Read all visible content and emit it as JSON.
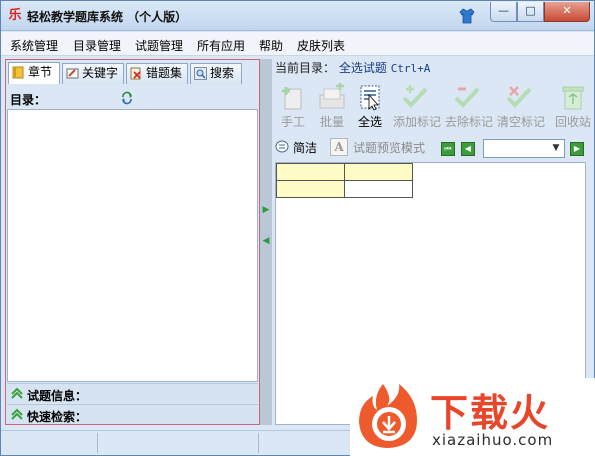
{
  "window": {
    "title": "轻松教学题库系统 （个人版）",
    "app_icon_glyph": "乐",
    "controls": {
      "minimize": "—",
      "maximize": "□",
      "close": "✕"
    }
  },
  "menu": {
    "items": [
      "系统管理",
      "目录管理",
      "试题管理",
      "所有应用",
      "帮助",
      "皮肤列表"
    ]
  },
  "left_panel": {
    "tabs": [
      {
        "label": "章节",
        "icon": "book-icon",
        "active": true
      },
      {
        "label": "关键字",
        "icon": "keyword-icon",
        "active": false
      },
      {
        "label": "错题集",
        "icon": "wrong-set-icon",
        "active": false
      },
      {
        "label": "搜索",
        "icon": "search-icon",
        "active": false
      }
    ],
    "catalog_label": "目录：",
    "sections": [
      {
        "label": "试题信息：",
        "icon": "expand-up-icon"
      },
      {
        "label": "快速检索：",
        "icon": "expand-up-icon"
      }
    ]
  },
  "splitter": {
    "right_arrow": "▶",
    "left_arrow": "◀"
  },
  "right_panel": {
    "current_dir_label": "当前目录：",
    "current_dir_value": "全选试题",
    "shortcut": "Ctrl+A",
    "toolbar": [
      {
        "label": "手工",
        "icon": "manual-add-icon",
        "enabled": false
      },
      {
        "label": "批量",
        "icon": "batch-icon",
        "enabled": false
      },
      {
        "label": "全选",
        "icon": "select-all-icon",
        "enabled": true
      },
      {
        "label": "添加标记",
        "icon": "add-mark-icon",
        "enabled": false
      },
      {
        "label": "去除标记",
        "icon": "remove-mark-icon",
        "enabled": false
      },
      {
        "label": "清空标记",
        "icon": "clear-mark-icon",
        "enabled": false
      },
      {
        "label": "回收站",
        "icon": "recycle-bin-icon",
        "enabled": false
      }
    ],
    "simple_label": "简洁",
    "preview_icon_letter": "A",
    "preview_label": "试题预览模式",
    "nav": {
      "first": "⏮",
      "prev": "◀",
      "next": "▶"
    },
    "select_value": "",
    "select_arrow": "▼"
  },
  "watermark": {
    "text": "下载火",
    "url": "xiazaihuo.com"
  },
  "colors": {
    "accent_green": "#3d9d3a",
    "watermark_red": "#e8462a",
    "cell_yellow": "#fffbc4",
    "left_border": "#c8677a"
  }
}
